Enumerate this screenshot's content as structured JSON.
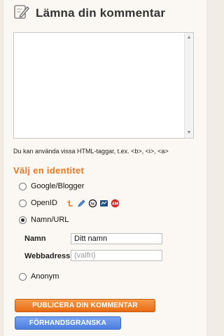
{
  "header": {
    "title": "Lämna din kommentar"
  },
  "comment_box": {
    "value": ""
  },
  "html_hint": "Du kan använda vissa HTML-taggar, t.ex. <b>, <i>, <a>",
  "identity": {
    "heading": "Välj en identitet",
    "options": [
      {
        "label": "Google/Blogger",
        "checked": false
      },
      {
        "label": "OpenID",
        "checked": false
      },
      {
        "label": "Namn/URL",
        "checked": true
      },
      {
        "label": "Anonym",
        "checked": false
      }
    ],
    "openid_icons": [
      "livejournal-icon",
      "pencil-icon",
      "wordpress-icon",
      "typepad-icon",
      "aim-icon"
    ]
  },
  "fields": {
    "name_label": "Namn",
    "name_value": "Ditt namn",
    "website_label": "Webbadress",
    "website_placeholder": "(valfri)"
  },
  "buttons": {
    "publish": "PUBLICERA DIN KOMMENTAR",
    "preview": "FÖRHANDSGRANSKA"
  },
  "colors": {
    "accent_orange": "#e87722",
    "button_blue": "#5a88e6"
  }
}
